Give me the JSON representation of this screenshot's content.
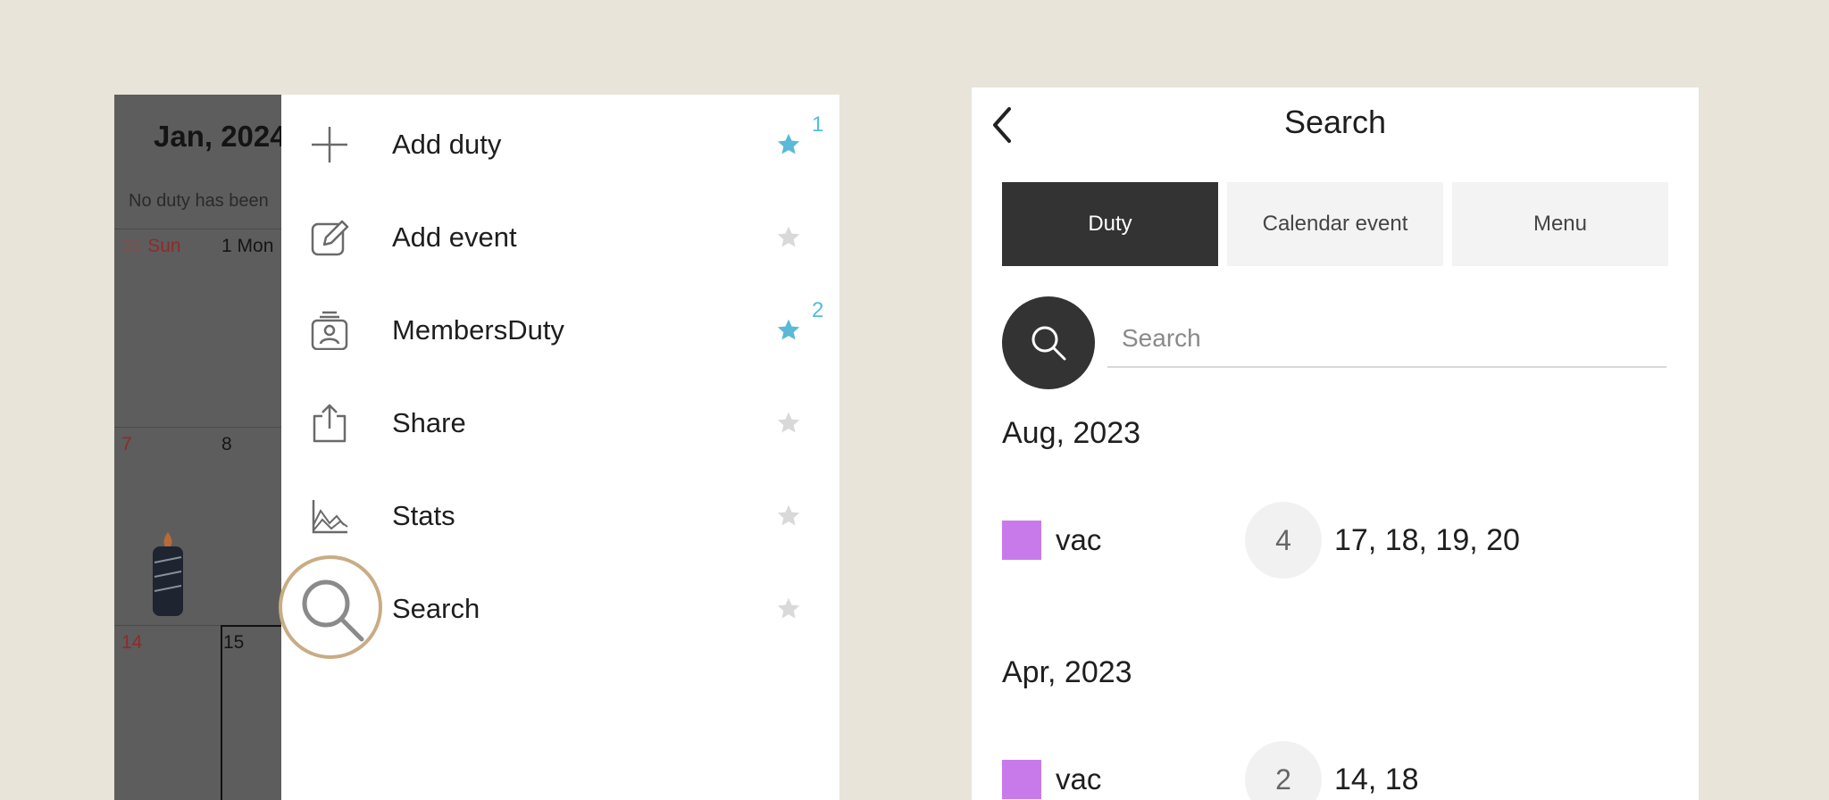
{
  "calendar": {
    "month_title": "Jan, 2024",
    "empty_note": "No duty has been",
    "weekday_sun": "Sun",
    "weekday_mon": "Mon",
    "days": {
      "d31": "31",
      "d1": "1",
      "d7": "7",
      "d8": "8",
      "d14": "14",
      "d15": "15"
    }
  },
  "menu": {
    "items": [
      {
        "label": "Add duty",
        "icon": "plus-icon",
        "favorite": true,
        "badge": "1"
      },
      {
        "label": "Add event",
        "icon": "edit-icon",
        "favorite": false,
        "badge": ""
      },
      {
        "label": "MembersDuty",
        "icon": "members-badge-icon",
        "favorite": true,
        "badge": "2"
      },
      {
        "label": "Share",
        "icon": "share-icon",
        "favorite": false,
        "badge": ""
      },
      {
        "label": "Stats",
        "icon": "stats-chart-icon",
        "favorite": false,
        "badge": ""
      },
      {
        "label": "Search",
        "icon": "search-icon",
        "favorite": false,
        "badge": ""
      }
    ],
    "colors": {
      "star_on": "#5ab9d6",
      "star_off": "#d9d9d9",
      "highlight_ring": "#c9ac84"
    }
  },
  "search_screen": {
    "title": "Search",
    "tabs": [
      {
        "label": "Duty",
        "active": true
      },
      {
        "label": "Calendar event",
        "active": false
      },
      {
        "label": "Menu",
        "active": false
      }
    ],
    "search": {
      "placeholder": "Search"
    },
    "results": [
      {
        "month": "Aug, 2023",
        "name": "vac",
        "color": "#c87aea",
        "count": "4",
        "dates": "17, 18, 19, 20"
      },
      {
        "month": "Apr, 2023",
        "name": "vac",
        "color": "#c87aea",
        "count": "2",
        "dates": "14, 18"
      }
    ]
  }
}
